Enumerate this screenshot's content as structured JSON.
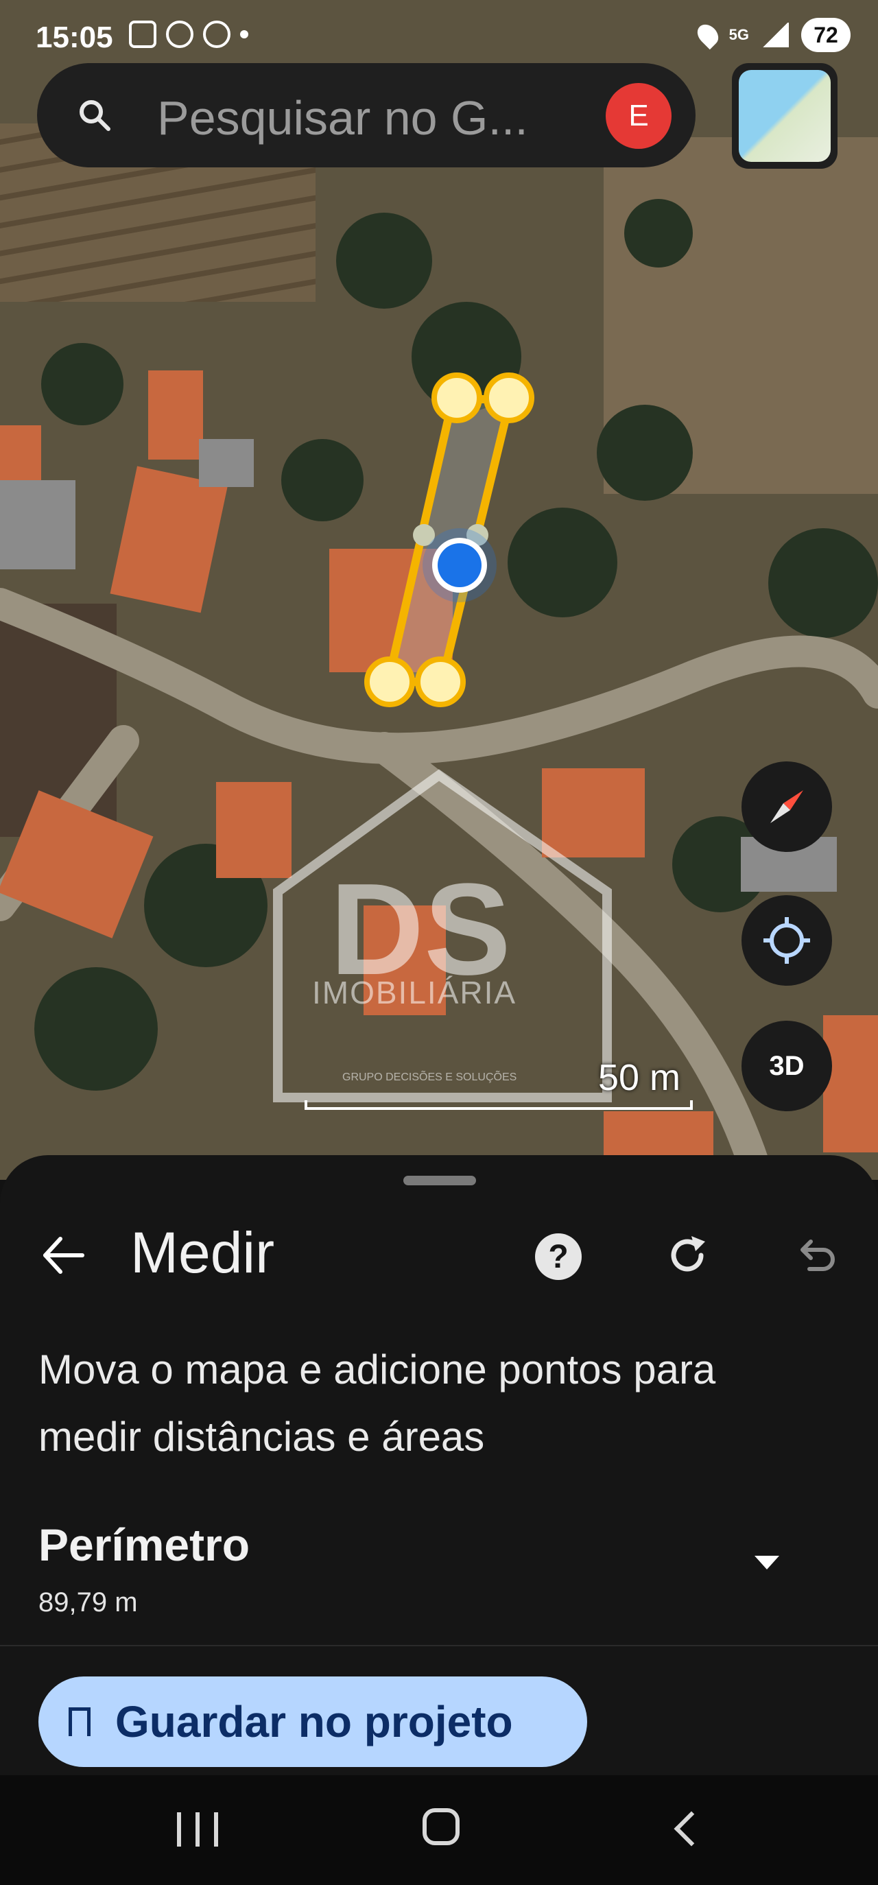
{
  "status_bar": {
    "time": "15:05",
    "network": "5G",
    "battery": "72",
    "icons": [
      "screen-record-icon",
      "whatsapp-icon",
      "messenger-icon",
      "location-icon",
      "signal-icon"
    ]
  },
  "search": {
    "placeholder": "Pesquisar no G...",
    "avatar_letter": "E"
  },
  "map": {
    "scale_label": "50 m",
    "three_d_label": "3D",
    "watermark": {
      "letters": "DS",
      "brand": "IMOBILIÁRIA",
      "tagline": "GRUPO DECISÕES E SOLUÇÕES"
    },
    "measure_color": "#f5b400",
    "location_color": "#1a73e8"
  },
  "sheet": {
    "title": "Medir",
    "instructions": "Mova o mapa e adicione pontos para medir distâncias e áreas",
    "metric_label": "Perímetro",
    "metric_value": "89,79 m",
    "save_label": "Guardar no projeto"
  },
  "colors": {
    "sheet_bg": "#151515",
    "save_button_bg": "#b6d6ff",
    "save_button_text": "#0c2d66",
    "avatar_bg": "#e53935"
  }
}
